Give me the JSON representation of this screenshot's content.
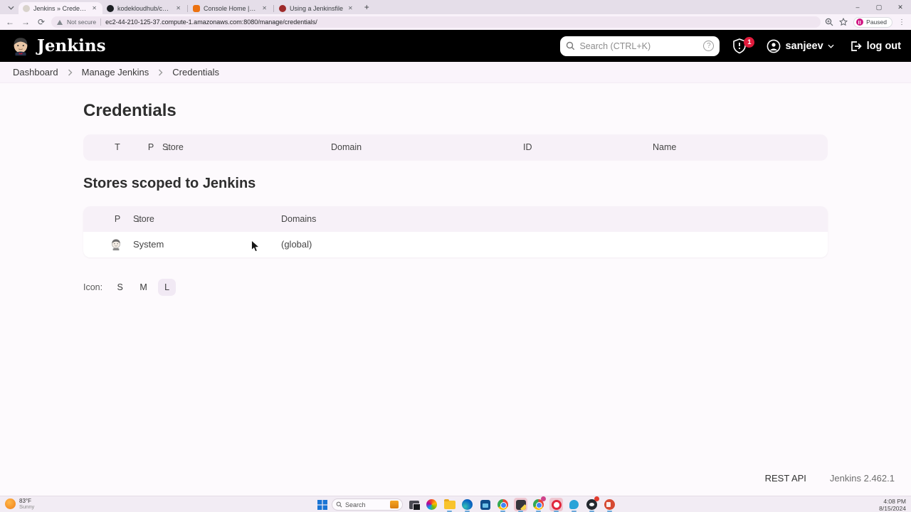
{
  "window": {
    "minimize": "–",
    "maximize": "▢",
    "close": "✕"
  },
  "browser": {
    "tabs": [
      {
        "title": "Jenkins » Credentials [Jenkins]"
      },
      {
        "title": "kodekloudhub/course-jenkins"
      },
      {
        "title": "Console Home | Console Hom..."
      },
      {
        "title": "Using a Jenkinsfile"
      }
    ],
    "close_glyph": "✕",
    "new_tab_glyph": "+",
    "security_label": "Not secure",
    "url": "ec2-44-210-125-37.compute-1.amazonaws.com:8080/manage/credentials/",
    "profile_label": "Paused",
    "kebab_glyph": "⋮"
  },
  "header": {
    "brand": "Jenkins",
    "search_placeholder": "Search (CTRL+K)",
    "help_glyph": "?",
    "badge_count": "1",
    "user": "sanjeev",
    "logout_label": "log out"
  },
  "breadcrumb": {
    "items": [
      "Dashboard",
      "Manage Jenkins",
      "Credentials"
    ]
  },
  "main": {
    "title": "Credentials",
    "credentials_table": {
      "col_t": "T",
      "col_p": "P",
      "col_store": "Store",
      "sort_arrow": "↓",
      "col_domain": "Domain",
      "col_id": "ID",
      "col_name": "Name"
    },
    "stores_heading": "Stores scoped to Jenkins",
    "stores_table": {
      "col_p": "P",
      "col_store": "Store",
      "sort_arrow": "↓",
      "col_domains": "Domains",
      "rows": [
        {
          "store": "System",
          "domains": "(global)"
        }
      ]
    },
    "icon_size": {
      "label": "Icon:",
      "small": "S",
      "medium": "M",
      "large": "L",
      "selected": "L"
    }
  },
  "footer": {
    "rest_api": "REST API",
    "version": "Jenkins 2.462.1"
  },
  "taskbar": {
    "weather": {
      "temp": "83°F",
      "condition": "Sunny"
    },
    "search_placeholder": "Search",
    "clock": {
      "time": "4:08 PM",
      "date": "8/15/2024"
    }
  },
  "colors": {
    "link": "#3d6cc0",
    "badge_red": "#e01b3c",
    "header_bg": "#000000",
    "selected_chip_bg": "#f1e9f4"
  }
}
